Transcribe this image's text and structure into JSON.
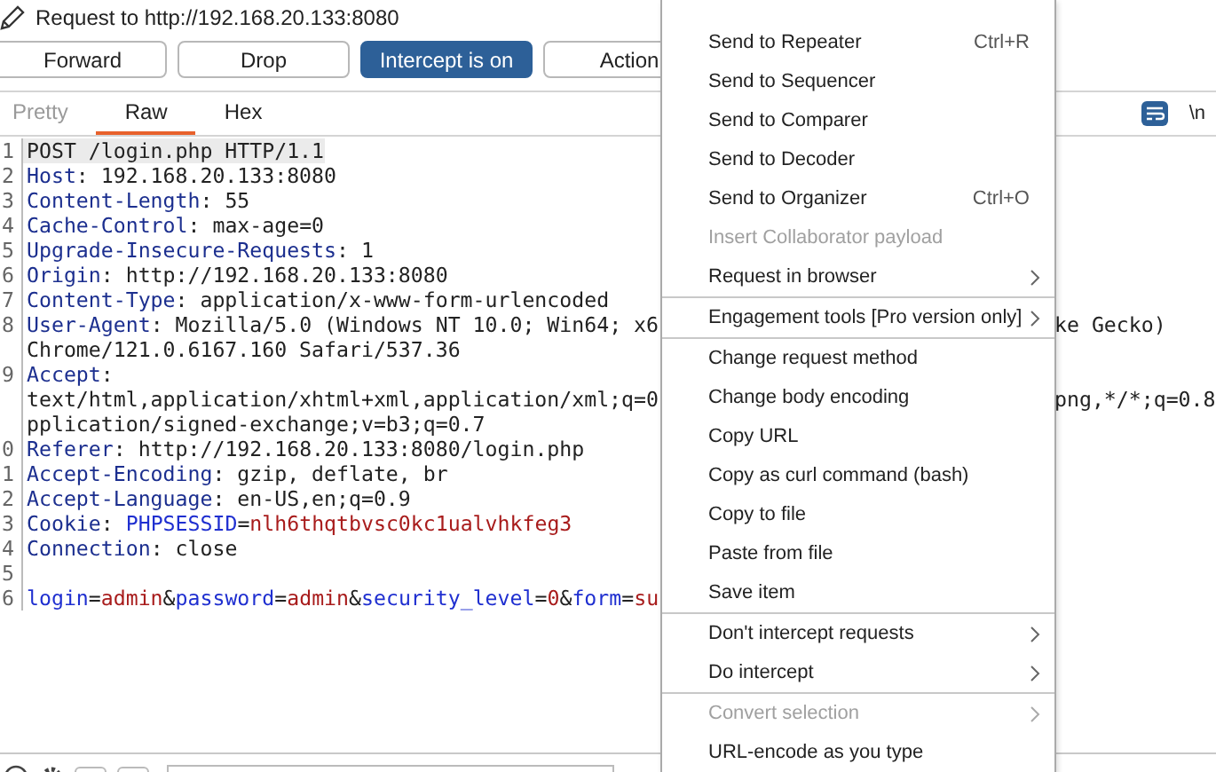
{
  "window": {
    "title": "Request to http://192.168.20.133:8080"
  },
  "toolbar": [
    {
      "label": "Forward",
      "selected": false
    },
    {
      "label": "Drop",
      "selected": false
    },
    {
      "label": "Intercept is on",
      "selected": true
    },
    {
      "label": "Action",
      "selected": false
    }
  ],
  "tabs": [
    {
      "label": "Pretty",
      "selected": false,
      "disabled": true
    },
    {
      "label": "Raw",
      "selected": true,
      "disabled": false
    },
    {
      "label": "Hex",
      "selected": false,
      "disabled": false
    }
  ],
  "editor_options": {
    "wrap_lines": true,
    "newline_label": "\\n"
  },
  "editor": [
    {
      "number": "1",
      "tokens": [
        {
          "kind": "text",
          "text": "POST /login.php HTTP/1.1"
        }
      ]
    },
    {
      "number": "2",
      "tokens": [
        {
          "kind": "key",
          "text": "Host"
        },
        {
          "kind": "text",
          "text": ": 192.168.20.133:8080"
        }
      ]
    },
    {
      "number": "3",
      "tokens": [
        {
          "kind": "key",
          "text": "Content-Length"
        },
        {
          "kind": "text",
          "text": ": 55"
        }
      ]
    },
    {
      "number": "4",
      "tokens": [
        {
          "kind": "key",
          "text": "Cache-Control"
        },
        {
          "kind": "text",
          "text": ": max-age=0"
        }
      ]
    },
    {
      "number": "5",
      "tokens": [
        {
          "kind": "key",
          "text": "Upgrade-Insecure-Requests"
        },
        {
          "kind": "text",
          "text": ": 1"
        }
      ]
    },
    {
      "number": "6",
      "tokens": [
        {
          "kind": "key",
          "text": "Origin"
        },
        {
          "kind": "text",
          "text": ": http://192.168.20.133:8080"
        }
      ]
    },
    {
      "number": "7",
      "tokens": [
        {
          "kind": "key",
          "text": "Content-Type"
        },
        {
          "kind": "text",
          "text": ": application/x-www-form-urlencoded"
        }
      ]
    },
    {
      "number": "8",
      "tokens": [
        {
          "kind": "key",
          "text": "User-Agent"
        },
        {
          "kind": "text",
          "text": ": Mozilla/5.0 (Windows NT 10.0; Win64; x6"
        }
      ],
      "tail": "ke Gecko)"
    },
    {
      "tokens": [
        {
          "kind": "text",
          "text": "Chrome/121.0.6167.160 Safari/537.36"
        }
      ]
    },
    {
      "number": "9",
      "tokens": [
        {
          "kind": "key",
          "text": "Accept"
        },
        {
          "kind": "text",
          "text": ":"
        }
      ]
    },
    {
      "tokens": [
        {
          "kind": "text",
          "text": "text/html,application/xhtml+xml,application/xml;q=0"
        }
      ],
      "tail": "png,*/*;q=0.8"
    },
    {
      "tokens": [
        {
          "kind": "text",
          "text": "pplication/signed-exchange;v=b3;q=0.7"
        }
      ]
    },
    {
      "number": "0",
      "tokens": [
        {
          "kind": "key",
          "text": "Referer"
        },
        {
          "kind": "text",
          "text": ": http://192.168.20.133:8080/login.php"
        }
      ]
    },
    {
      "number": "1",
      "tokens": [
        {
          "kind": "key",
          "text": "Accept-Encoding"
        },
        {
          "kind": "text",
          "text": ": gzip, deflate, br"
        }
      ]
    },
    {
      "number": "2",
      "tokens": [
        {
          "kind": "key",
          "text": "Accept-Language"
        },
        {
          "kind": "text",
          "text": ": en-US,en;q=0.9"
        }
      ]
    },
    {
      "number": "3",
      "tokens": [
        {
          "kind": "key",
          "text": "Cookie"
        },
        {
          "kind": "text",
          "text": ": "
        },
        {
          "kind": "name",
          "text": "PHPSESSID"
        },
        {
          "kind": "text",
          "text": "="
        },
        {
          "kind": "value",
          "text": "nlh6thqtbvsc0kc1ualvhkfeg3"
        }
      ]
    },
    {
      "number": "4",
      "tokens": [
        {
          "kind": "key",
          "text": "Connection"
        },
        {
          "kind": "text",
          "text": ": close"
        }
      ]
    },
    {
      "number": "5"
    },
    {
      "number": "6",
      "tokens": [
        {
          "kind": "name",
          "text": "login"
        },
        {
          "kind": "text",
          "text": "="
        },
        {
          "kind": "value",
          "text": "admin"
        },
        {
          "kind": "text",
          "text": "&"
        },
        {
          "kind": "name",
          "text": "password"
        },
        {
          "kind": "text",
          "text": "="
        },
        {
          "kind": "value",
          "text": "admin"
        },
        {
          "kind": "text",
          "text": "&"
        },
        {
          "kind": "name",
          "text": "security_level"
        },
        {
          "kind": "text",
          "text": "="
        },
        {
          "kind": "value",
          "text": "0"
        },
        {
          "kind": "text",
          "text": "&"
        },
        {
          "kind": "name",
          "text": "form"
        },
        {
          "kind": "text",
          "text": "="
        },
        {
          "kind": "value",
          "text": "su"
        }
      ]
    }
  ],
  "context_menu": [
    {
      "label": "Send to Repeater",
      "shortcut": "Ctrl+R",
      "disabled": false
    },
    {
      "label": "Send to Sequencer",
      "disabled": false
    },
    {
      "label": "Send to Comparer",
      "disabled": false
    },
    {
      "label": "Send to Decoder",
      "disabled": false
    },
    {
      "label": "Send to Organizer",
      "shortcut": "Ctrl+O",
      "disabled": false
    },
    {
      "label": "Insert Collaborator payload",
      "disabled": true
    },
    {
      "label": "Request in browser",
      "disabled": false,
      "submenu": true
    },
    {
      "label": "Engagement tools [Pro version only]",
      "disabled": false,
      "submenu": true,
      "divider_before": true
    },
    {
      "label": "Change request method",
      "disabled": false,
      "divider_before": true
    },
    {
      "label": "Change body encoding",
      "disabled": false
    },
    {
      "label": "Copy URL",
      "disabled": false
    },
    {
      "label": "Copy as curl command (bash)",
      "disabled": false
    },
    {
      "label": "Copy to file",
      "disabled": false
    },
    {
      "label": "Paste from file",
      "disabled": false
    },
    {
      "label": "Save item",
      "disabled": false
    },
    {
      "label": "Don't intercept requests",
      "disabled": false,
      "submenu": true,
      "divider_before": true
    },
    {
      "label": "Do intercept",
      "disabled": false,
      "submenu": true
    },
    {
      "label": "Convert selection",
      "disabled": true,
      "submenu": true,
      "divider_before": true
    },
    {
      "label": "URL-encode as you type",
      "disabled": false
    }
  ]
}
